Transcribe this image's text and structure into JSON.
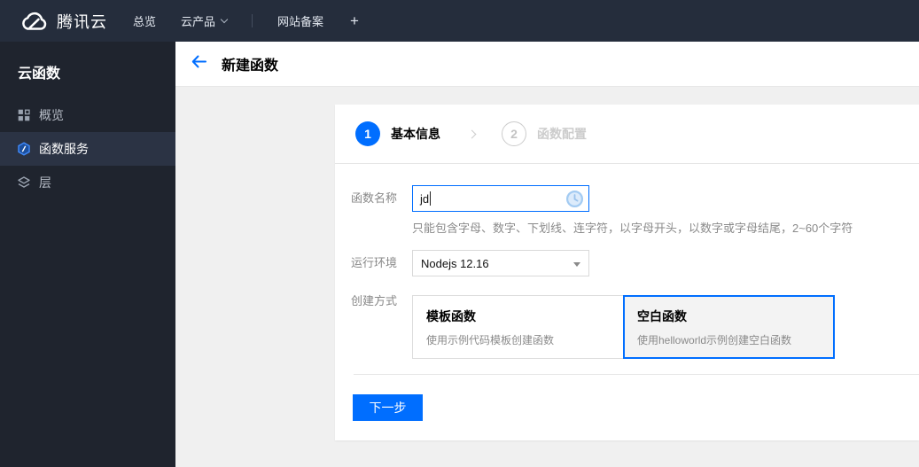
{
  "colors": {
    "accent_blue": "#006eff",
    "topbar_bg": "#252d3c",
    "sidebar_bg": "#1f242e",
    "sidebar_active_bg": "#2b3344",
    "content_bg": "#f0f0f0",
    "muted_text": "#8a8a8a",
    "step_inactive": "#cccccc",
    "pending_icon_blue": "#a3cbf2"
  },
  "topbar": {
    "brand": "腾讯云",
    "brand_icon": "tencent-cloud-logo-icon",
    "items": [
      {
        "label": "总览"
      },
      {
        "label": "云产品",
        "caret_icon": "chevron-down-icon"
      },
      {
        "label": "网站备案"
      },
      {
        "label": "+"
      }
    ]
  },
  "sidebar": {
    "title": "云函数",
    "items": [
      {
        "label": "概览",
        "icon": "grid-overview-icon",
        "active": false
      },
      {
        "label": "函数服务",
        "icon": "function-hexagon-icon",
        "active": true
      },
      {
        "label": "层",
        "icon": "layers-icon",
        "active": false
      }
    ]
  },
  "header": {
    "back_icon": "arrow-left-icon",
    "title": "新建函数"
  },
  "wizard": {
    "steps": [
      {
        "number": "1",
        "label": "基本信息",
        "state": "active"
      },
      {
        "number": "2",
        "label": "函数配置",
        "state": "inactive"
      }
    ],
    "separator_icon": "chevron-right-icon"
  },
  "form": {
    "function_name": {
      "label": "函数名称",
      "value": "jd",
      "status_icon": "clock-pending-icon",
      "help": "只能包含字母、数字、下划线、连字符，以字母开头，以数字或字母结尾，2~60个字符"
    },
    "runtime": {
      "label": "运行环境",
      "value": "Nodejs 12.16",
      "caret_icon": "triangle-down-icon"
    },
    "creation_method": {
      "label": "创建方式",
      "options": [
        {
          "title": "模板函数",
          "desc": "使用示例代码模板创建函数",
          "selected": false
        },
        {
          "title": "空白函数",
          "desc": "使用helloworld示例创建空白函数",
          "selected": true
        }
      ]
    },
    "next_button": "下一步"
  }
}
